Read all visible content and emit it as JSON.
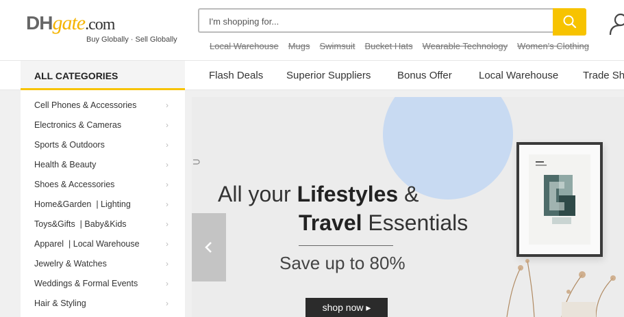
{
  "logo": {
    "dh": "DH",
    "gate": "gate",
    "com": ".com",
    "tagline": "Buy Globally · Sell Globally"
  },
  "search": {
    "placeholder": "I'm shopping for..."
  },
  "hot_words": [
    "Local Warehouse",
    "Mugs",
    "Swimsuit",
    "Bucket Hats",
    "Wearable Technology",
    "Women's Clothing"
  ],
  "nav": {
    "all_categories": "ALL CATEGORIES",
    "items": [
      "Flash Deals",
      "Superior Suppliers",
      "Bonus Offer",
      "Local Warehouse",
      "Trade Sho"
    ]
  },
  "categories": [
    "Cell Phones & Accessories",
    "Electronics & Cameras",
    "Sports & Outdoors",
    "Health & Beauty",
    "Shoes & Accessories",
    "Home&Garden  | Lighting",
    "Toys&Gifts  | Baby&Kids",
    "Apparel  | Local Warehouse",
    "Jewelry & Watches",
    "Weddings & Formal Events",
    "Hair & Styling"
  ],
  "banner": {
    "line1_prefix": "All your ",
    "line1_bold": "Lifestyles",
    "line1_suffix": " &",
    "line2_bold": "Travel",
    "line2_suffix": " Essentials",
    "subline": "Save up to 80%",
    "button": "shop now"
  },
  "colors": {
    "accent": "#f7c300",
    "banner_bg": "#ececec",
    "circle": "#c8daf2"
  },
  "icons": {
    "search": "search-icon",
    "user": "user-icon",
    "chevron": "chevron-right-icon",
    "arrow_left": "arrow-left-icon"
  }
}
